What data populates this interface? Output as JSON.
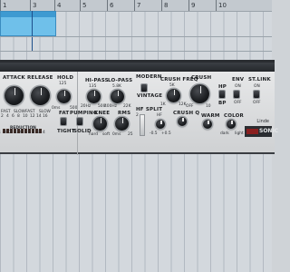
{
  "ruler": {
    "markers": [
      "1",
      "3",
      "4",
      "5",
      "6",
      "7",
      "8",
      "9",
      "10"
    ]
  },
  "plugin": {
    "attack": {
      "label": "ATTACK",
      "fast": "FAST",
      "slow": "SLOW"
    },
    "release": {
      "label": "RELEASE",
      "fast": "FAST",
      "slow": "SLOW"
    },
    "hold": {
      "label": "HOLD",
      "value": "125",
      "min": "0ms",
      "max": "500"
    },
    "hipass": {
      "label": "HI-PASS",
      "value": "135",
      "min": "20Hz",
      "max": "500"
    },
    "lopass": {
      "label": "LO-PASS",
      "value": "5.8K",
      "min": "400Hz",
      "max": "22K"
    },
    "modern": "MODERN",
    "vintage": "VINTAGE",
    "hf_split": {
      "label": "HF SPLIT",
      "hf": "HF",
      "minus": "-0.5",
      "plus": "+0.5",
      "val2": "2"
    },
    "crush_freq": {
      "label": "CRUSH FREQ",
      "value": "5K",
      "min": "1K",
      "max": "12K"
    },
    "crush": {
      "label": "CRUSH",
      "off": "OFF",
      "max": "10"
    },
    "hp": "HP",
    "bp": "BP",
    "env": {
      "label": "ENV",
      "on": "ON",
      "off": "OFF"
    },
    "stlink": {
      "label": "ST.LINK",
      "on": "ON",
      "off": "OFF"
    },
    "fat": "FAT",
    "pumping": "PUMPING",
    "knee": {
      "label": "KNEE",
      "hard": "hard",
      "soft": "soft"
    },
    "rms": {
      "label": "RMS",
      "min": "0ms",
      "max": "25"
    },
    "tight": "TIGHT",
    "solid": "SOLID",
    "crush_q": "CRUSH Q",
    "warm": "WARM",
    "color": {
      "label": "COLOR",
      "dark": "dark",
      "light": "light"
    },
    "reduction_label": "REDUCTION",
    "meter_scale": [
      "2",
      "4",
      "6",
      "8",
      "10",
      "12",
      "14",
      "16"
    ],
    "bottom_scale": [
      "4",
      "3",
      "2",
      "1",
      "0",
      "+1",
      "2",
      "3",
      "4"
    ],
    "brand": {
      "line1": "Linde",
      "line2": "SONIC"
    }
  }
}
